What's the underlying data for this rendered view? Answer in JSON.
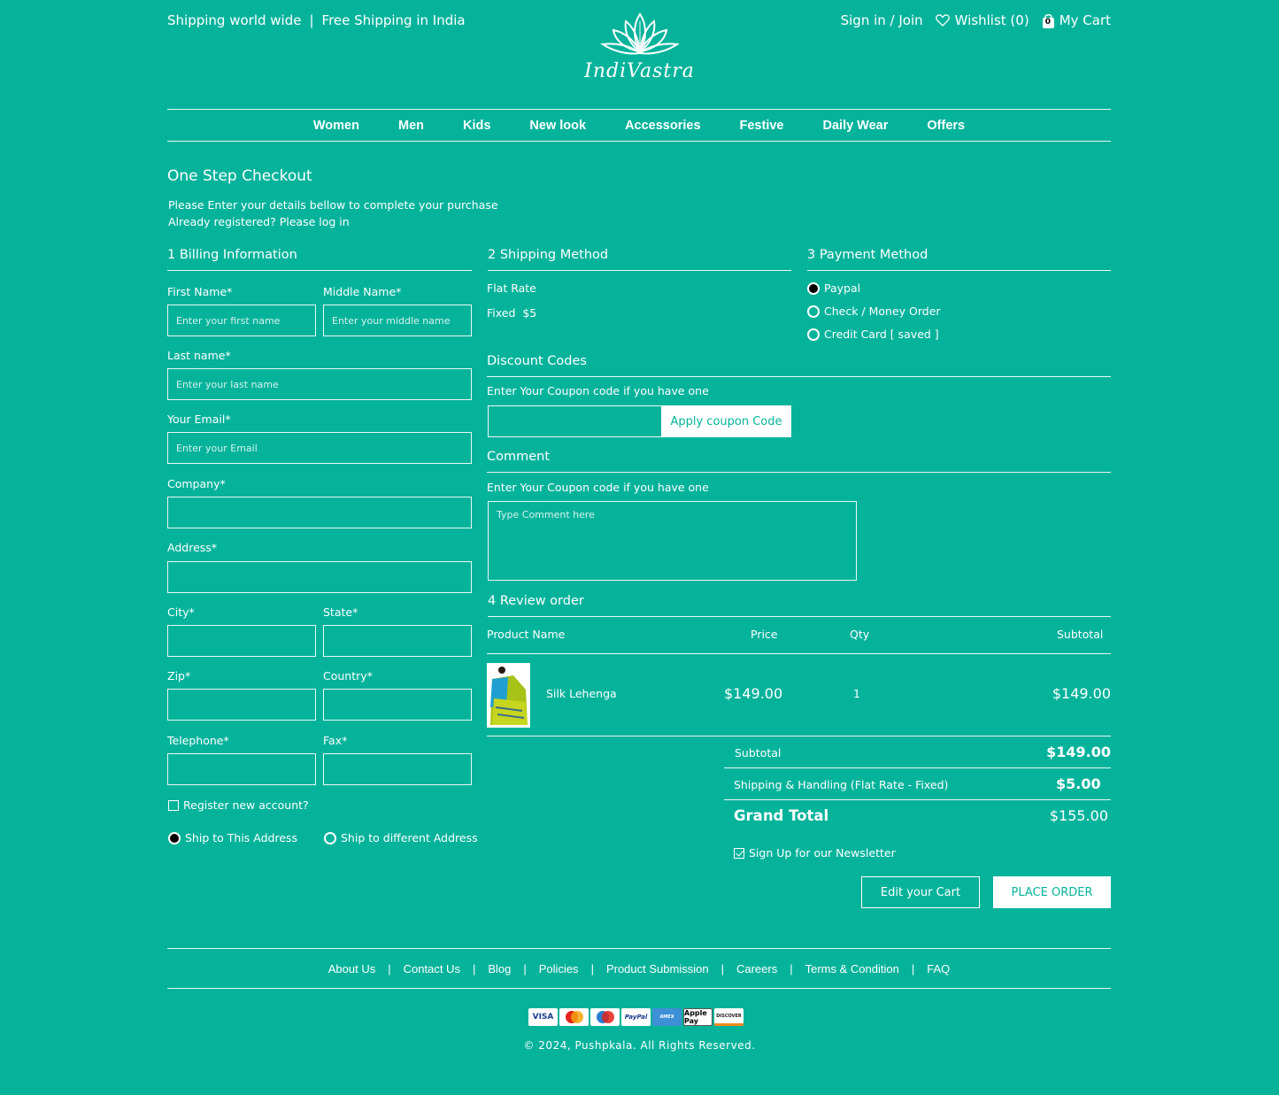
{
  "header": {
    "shipping_text": "Shipping world wide",
    "separator": "|",
    "free_shipping_text": "Free Shipping in India",
    "brand": "IndiVastra",
    "sign_in": "Sign in / Join",
    "wishlist": "Wishlist (0)",
    "cart_count": "0",
    "cart": "My Cart"
  },
  "nav": [
    "Women",
    "Men",
    "Kids",
    "New look",
    "Accessories",
    "Festive",
    "Daily Wear",
    "Offers"
  ],
  "checkout": {
    "title": "One Step Checkout",
    "intro_line1": "Please Enter your details bellow to complete your purchase",
    "intro_line2": "Already registered? Please log in"
  },
  "billing": {
    "heading": "1 Billing Information",
    "first_name_label": "First Name*",
    "first_name_placeholder": "Enter your first name",
    "middle_name_label": "Middle Name*",
    "middle_name_placeholder": "Enter your middle name",
    "last_name_label": "Last name*",
    "last_name_placeholder": "Enter your last name",
    "email_label": "Your Email*",
    "email_placeholder": "Enter your Email",
    "company_label": "Company*",
    "address_label": "Address*",
    "city_label": "City*",
    "state_label": "State*",
    "zip_label": "Zip*",
    "country_label": "Country*",
    "telephone_label": "Telephone*",
    "fax_label": "Fax*",
    "register_label": "Register new account?",
    "register_checked": false,
    "ship_this": "Ship to This Address",
    "ship_different": "Ship to different Address",
    "ship_selected": "this"
  },
  "shipping": {
    "heading": "2 Shipping Method",
    "rate_name": "Flat Rate",
    "rate_value": "Fixed  $5"
  },
  "payment": {
    "heading": "3 Payment Method",
    "options": [
      "Paypal",
      "Check / Money Order",
      "Credit Card [ saved ]"
    ],
    "selected": "Paypal"
  },
  "discount": {
    "heading": "Discount Codes",
    "hint": "Enter Your Coupon code if you have one",
    "input_value": "",
    "apply_label": "Apply coupon Code"
  },
  "comment": {
    "heading": "Comment",
    "hint": "Enter Your Coupon code if you have one",
    "placeholder": "Type Comment here"
  },
  "review": {
    "heading": "4 Review order",
    "columns": [
      "Product Name",
      "Price",
      "Qty",
      "Subtotal"
    ],
    "items": [
      {
        "name": "Silk Lehenga",
        "price": "$149.00",
        "qty": "1",
        "subtotal": "$149.00",
        "image": "saree-product-image"
      }
    ],
    "subtotal_label": "Subtotal",
    "subtotal_value": "$149.00",
    "shipping_label": "Shipping & Handling (Flat Rate - Fixed)",
    "shipping_value": "$5.00",
    "grand_total_label": "Grand Total",
    "grand_total_value": "$155.00",
    "newsletter_label": "Sign Up for our Newsletter",
    "newsletter_checked": true,
    "edit_cart_label": "Edit your Cart",
    "place_order_label": "PLACE ORDER"
  },
  "footer": {
    "links": [
      "About Us",
      "Contact Us",
      "Blog",
      "Policies",
      "Product Submission",
      "Careers",
      "Terms & Condition",
      "FAQ"
    ],
    "payment_cards": [
      "VISA",
      "MasterCard",
      "Maestro",
      "PayPal",
      "AMEX",
      "Apple Pay",
      "DISCOVER"
    ],
    "copyright": "© 2024, Pushpkala. All Rights Reserved."
  },
  "colors": {
    "background": "#05b39b",
    "text": "#ffffff",
    "accent_button_text": "#05b39b"
  }
}
